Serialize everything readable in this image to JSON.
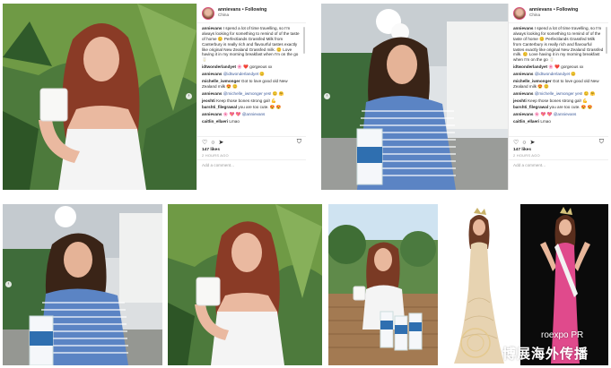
{
  "posts": [
    {
      "username": "annievans",
      "follow": "Following",
      "location": "China",
      "lines": [
        {
          "user": "annievans",
          "text": "I spend a lot of time travelling, so I'm always looking for something to remind of of the taste of home 😊 Perfectlands Grassfed Milk from Canterbury is really rich and flavourful tastes exactly like original New Zealand Grassfed milk. 😊 Love having it in my morning breakfast when I'm on the go 🥛"
        },
        {
          "user": "idtwonderlandyet",
          "text": "🌸 ❤️ gorgeous xx"
        },
        {
          "user": "annievans",
          "text": "@idtwonderlandyet 😊"
        },
        {
          "user": "michelle_iwmonger",
          "text": "Got to love good old New Zealand milk 😍 😊"
        },
        {
          "user": "annievans",
          "text": "@michelle_iwmonger yes! 😊 🤗"
        },
        {
          "user": "jeoshti",
          "text": "Keep those bones strong gal! 💪"
        },
        {
          "user": "barshti_filegrawal",
          "text": "you are too cute. 😍 😍"
        },
        {
          "user": "annievans",
          "text": "🌸 💖 💖 @annievans"
        },
        {
          "user": "caitlin_ellaeri",
          "text": "Lmao"
        }
      ],
      "likes": "147 likes",
      "time": "2 HOURS AGO",
      "comment_placeholder": "Add a comment..."
    },
    {
      "username": "annievans",
      "follow": "Following",
      "location": "China",
      "lines": [
        {
          "user": "annievans",
          "text": "I spend a lot of time travelling, so I'm always looking for something to remind of of the taste of home 😊 Perfectlands Grassfed Milk from Canterbury is really rich and flavourful tastes exactly like original New Zealand Grassfed milk. 😊 Love having it in my morning breakfast when I'm on the go 🥛"
        },
        {
          "user": "idtwonderlandyet",
          "text": "🌸 ❤️ gorgeous xx"
        },
        {
          "user": "annievans",
          "text": "@idtwonderlandyet 😊"
        },
        {
          "user": "michelle_iwmonger",
          "text": "Got to love good old New Zealand milk 😍 😊"
        },
        {
          "user": "annievans",
          "text": "@michelle_iwmonger yes! 😊 🤗"
        },
        {
          "user": "jeoshti",
          "text": "Keep those bones strong gal! 💪"
        },
        {
          "user": "barshti_filegrawal",
          "text": "you are too cute. 😍 😍"
        },
        {
          "user": "annievans",
          "text": "🌸 💖 💖 @annievans"
        },
        {
          "user": "caitlin_ellaeri",
          "text": "Lmao"
        }
      ],
      "likes": "147 likes",
      "time": "2 HOURS AGO",
      "comment_placeholder": "Add a comment..."
    }
  ],
  "watermark": {
    "line1": "roexpo PR",
    "line2": "博展海外传播"
  },
  "colors": {
    "milk_bottle": "#2f6fb0",
    "stripe_blue": "#5b84c4",
    "pink_dress": "#e04a8c"
  }
}
